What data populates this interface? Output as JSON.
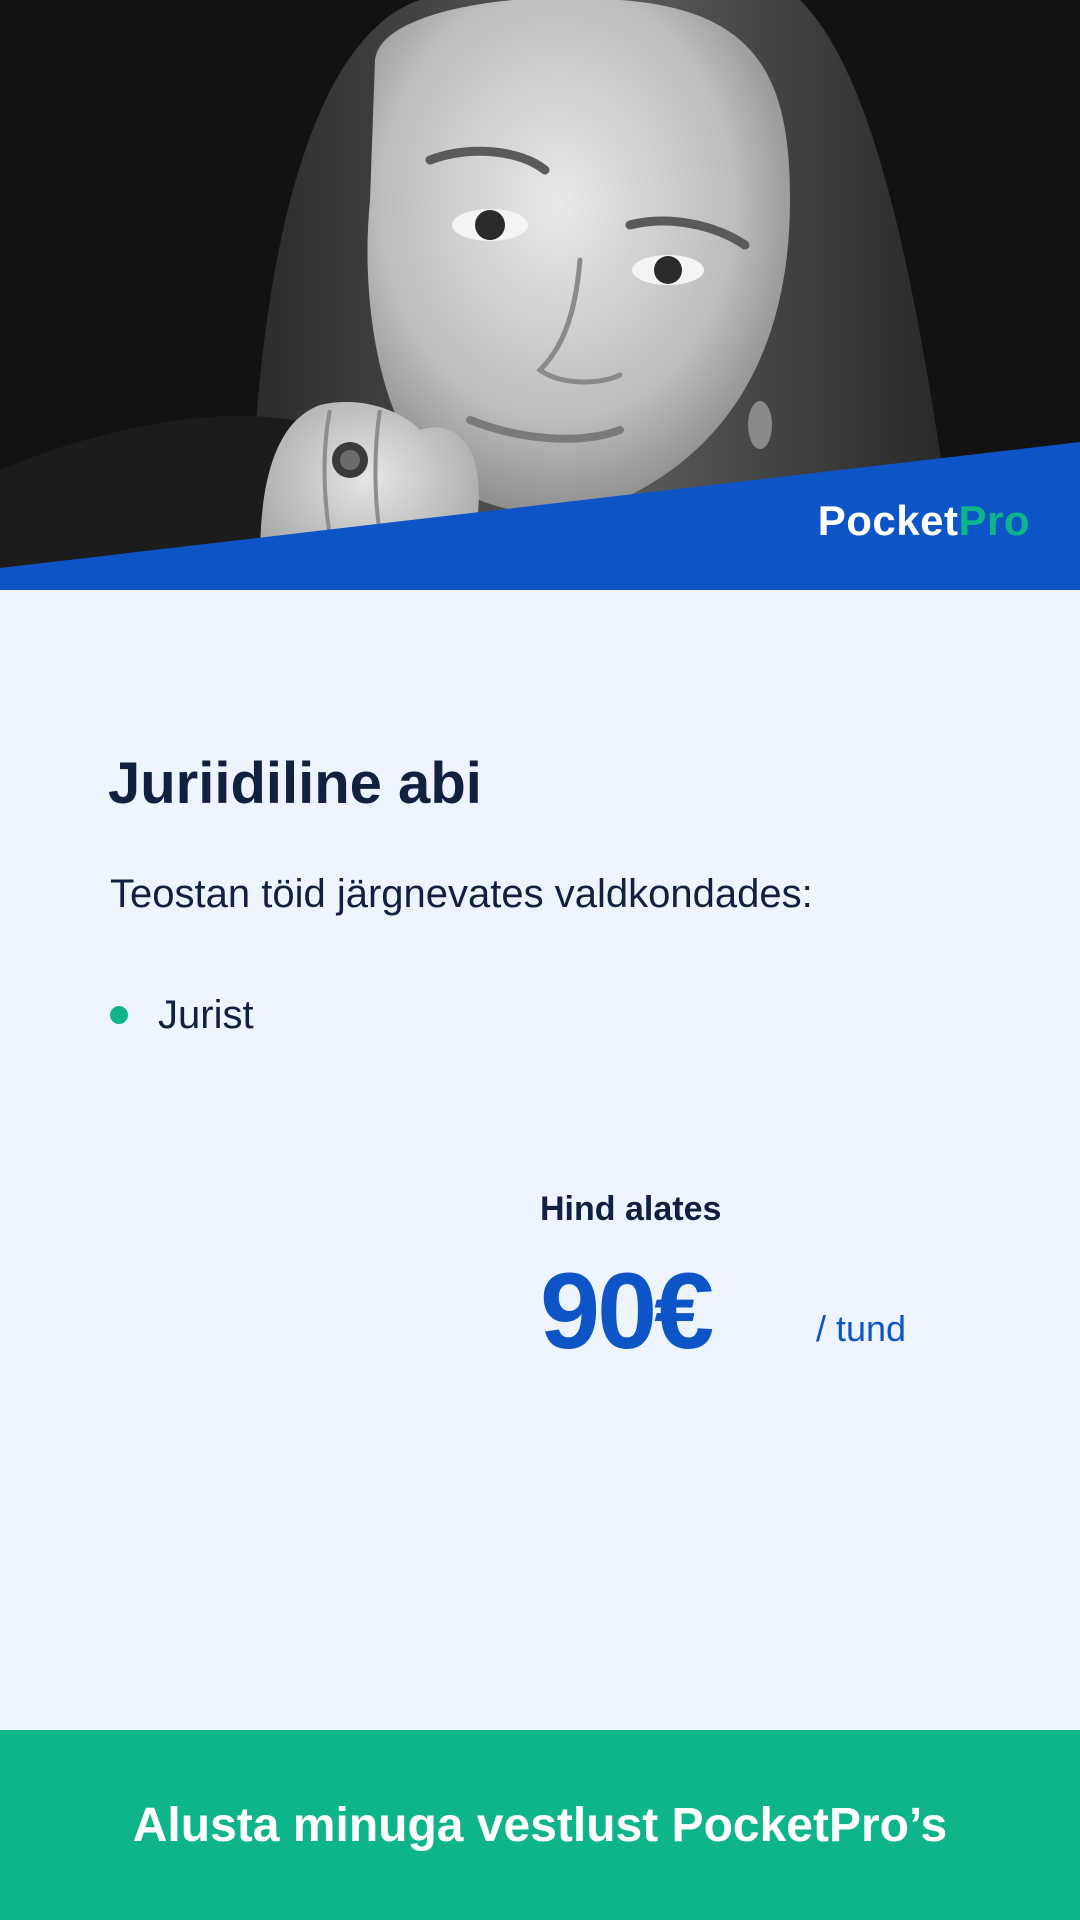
{
  "colors": {
    "brand_blue": "#0D55C7",
    "accent_green": "#0FB58A",
    "text_dark": "#12203F",
    "background": "#EEF4FE"
  },
  "hero": {
    "image_icon": "portrait-photo",
    "brand_name_part1": "Pocket",
    "brand_name_part2": "Pro"
  },
  "main": {
    "title": "Juriidiline abi",
    "subtitle": "Teostan töid järgnevates valdkondades:",
    "services": [
      {
        "label": "Jurist"
      }
    ]
  },
  "price": {
    "label": "Hind alates",
    "value": "90€",
    "unit": "/ tund"
  },
  "cta": {
    "label": "Alusta minuga vestlust PocketPro’s"
  }
}
